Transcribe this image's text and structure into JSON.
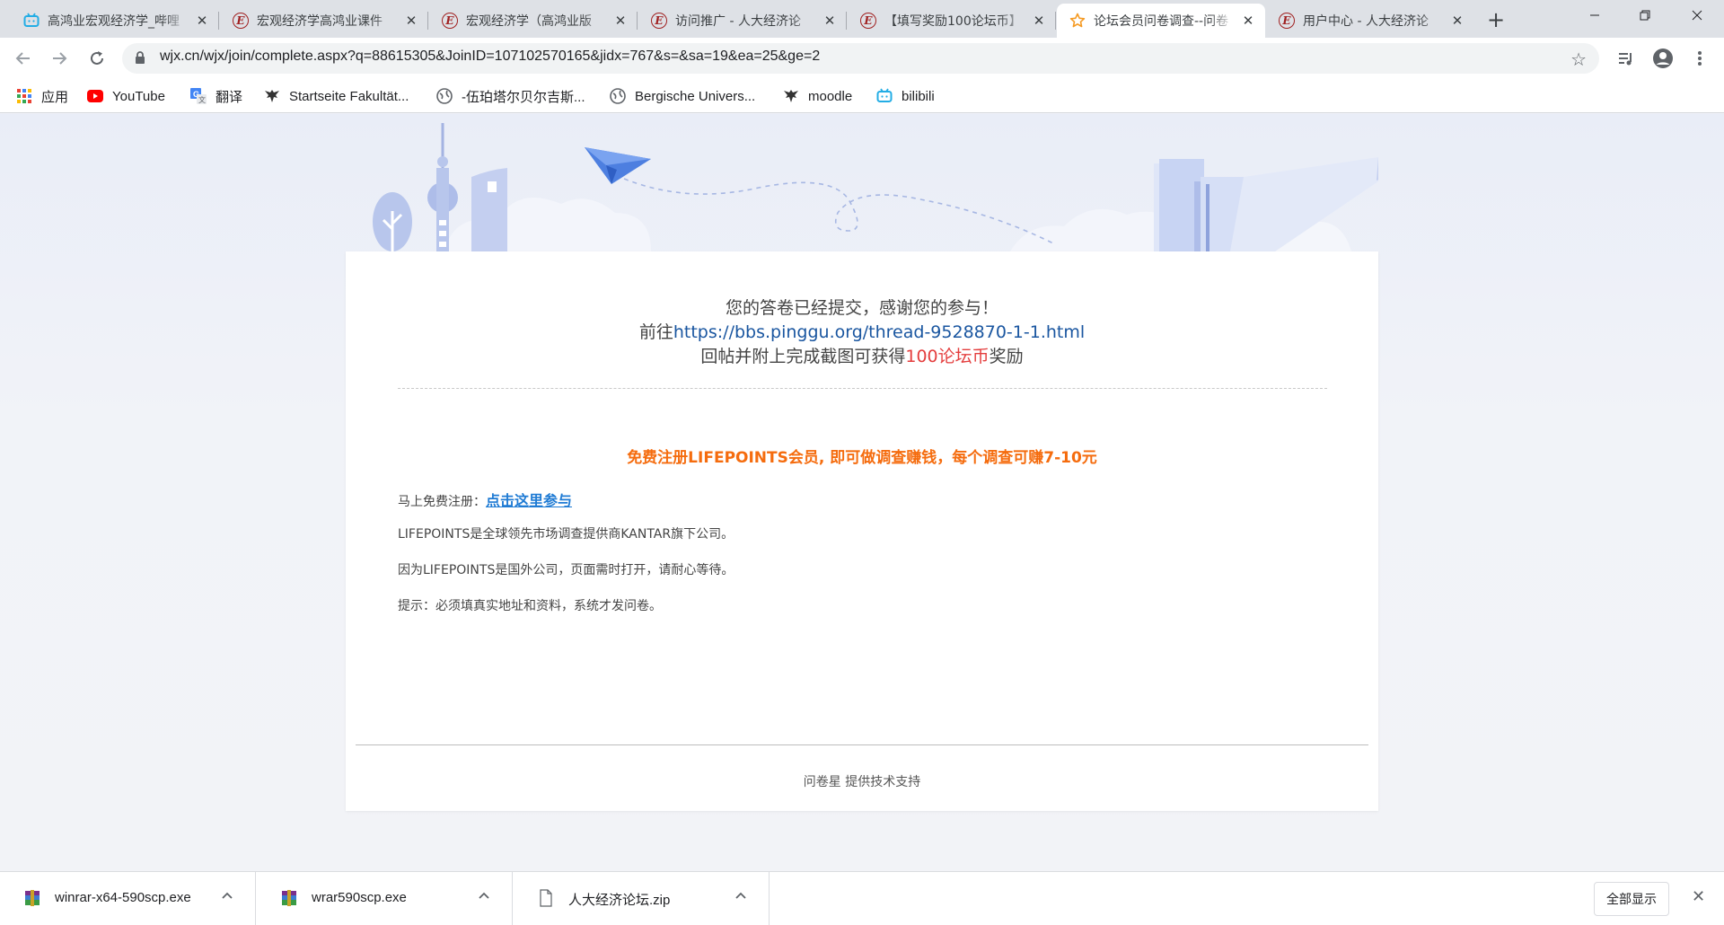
{
  "tabs": [
    {
      "title": "高鸿业宏观经济学_哔哩",
      "icon": "bilibili-icon",
      "active": false
    },
    {
      "title": "宏观经济学高鸿业课件",
      "icon": "pinggu-e-icon",
      "active": false
    },
    {
      "title": "宏观经济学（高鸿业版",
      "icon": "pinggu-e-icon",
      "active": false
    },
    {
      "title": "访问推广 - 人大经济论",
      "icon": "pinggu-e-icon",
      "active": false
    },
    {
      "title": "【填写奖励100论坛币】",
      "icon": "pinggu-e-icon",
      "active": false
    },
    {
      "title": "论坛会员问卷调查--问卷",
      "icon": "star-icon",
      "active": true
    },
    {
      "title": "用户中心 - 人大经济论",
      "icon": "pinggu-e-icon",
      "active": false
    }
  ],
  "url": "wjx.cn/wjx/join/complete.aspx?q=88615305&JoinID=107102570165&jidx=767&s=&sa=19&ea=25&ge=2",
  "bookmarks": [
    {
      "label": "应用",
      "icon": "apps-grid-icon"
    },
    {
      "label": "YouTube",
      "icon": "youtube-icon"
    },
    {
      "label": "翻译",
      "icon": "translate-icon"
    },
    {
      "label": "Startseite Fakultät...",
      "icon": "eagle-icon"
    },
    {
      "label": "-伍珀塔尔贝尔吉斯...",
      "icon": "globe-icon"
    },
    {
      "label": "Bergische Univers...",
      "icon": "globe-icon"
    },
    {
      "label": "moodle",
      "icon": "eagle-icon"
    },
    {
      "label": "bilibili",
      "icon": "bilibili-icon"
    }
  ],
  "message": {
    "line1": "您的答卷已经提交，感谢您的参与！",
    "line2_prefix": "前往",
    "line2_link": "https://bbs.pinggu.org/thread-9528870-1-1.html",
    "line3_prefix": "回帖并附上完成截图可获得",
    "line3_highlight": "100论坛币",
    "line3_suffix": "奖励"
  },
  "promo": {
    "title": "免费注册LIFEPOINTS会员, 即可做调查赚钱，每个调查可赚7-10元",
    "register_label": "马上免费注册：",
    "register_link": "点击这里参与",
    "info1": "LIFEPOINTS是全球领先市场调查提供商KANTAR旗下公司。",
    "info2": "因为LIFEPOINTS是国外公司，页面需时打开，请耐心等待。",
    "info3": "提示：必须填真实地址和资料，系统才发问卷。"
  },
  "footer": "问卷星 提供技术支持",
  "downloads": [
    {
      "name": "winrar-x64-590scp.exe",
      "icon": "winrar-icon"
    },
    {
      "name": "wrar590scp.exe",
      "icon": "winrar-icon"
    },
    {
      "name": "人大经济论坛.zip",
      "icon": "file-icon"
    }
  ],
  "show_all_label": "全部显示"
}
